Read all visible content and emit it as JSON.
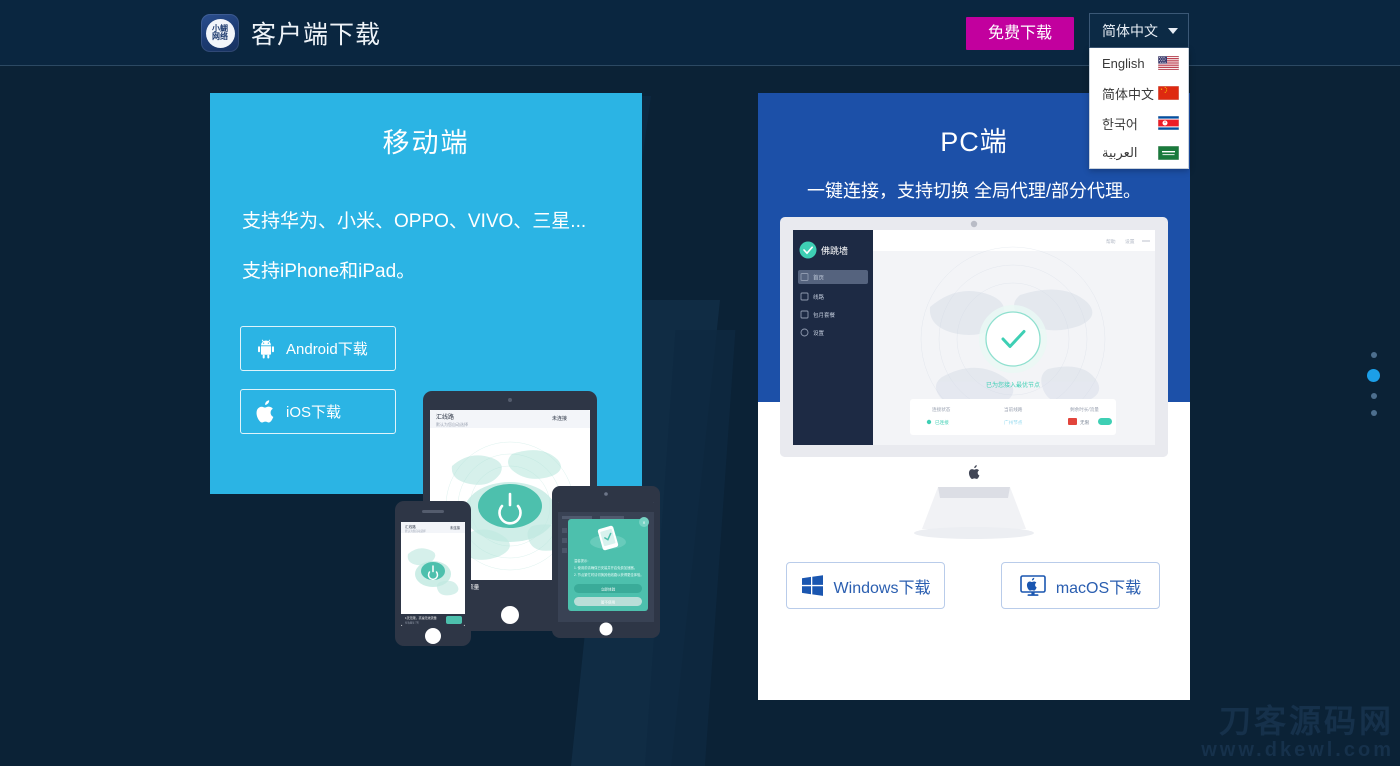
{
  "header": {
    "logo_text_top": "小蝴",
    "logo_text_bottom": "网络",
    "title": "客户端下载",
    "free_download_label": "免费下载",
    "language_selected": "简体中文",
    "accent_pink": "#c2009e",
    "bar_color": "#0a2640"
  },
  "language_menu": [
    {
      "label": "English",
      "flag": "us-flag-icon"
    },
    {
      "label": "简体中文",
      "flag": "cn-flag-icon"
    },
    {
      "label": "한국어",
      "flag": "kp-flag-icon"
    },
    {
      "label": "العربية",
      "flag": "sa-flag-icon"
    }
  ],
  "mobile": {
    "title": "移动端",
    "line1": "支持华为、小米、OPPO、VIVO、三星...",
    "line2": "支持iPhone和iPad。",
    "android_label": "Android下载",
    "ios_label": "iOS下载",
    "bg_color": "#2bb4e4"
  },
  "pc": {
    "title": "PC端",
    "subtitle": "一键连接，支持切换 全局代理/部分代理。",
    "windows_label": "Windows下载",
    "macos_label": "macOS下载",
    "bg_color": "#1c50a8"
  },
  "screen_app": {
    "brand": "佛跳墙",
    "nav": [
      "首页",
      "线路",
      "包月套餐",
      "设置"
    ],
    "status_text": "已为您接入最优节点",
    "card_headers": [
      "连接状态",
      "当前线路",
      "剩余时长/流量"
    ],
    "card_values": [
      "已连接",
      "广州节点",
      "无限"
    ]
  },
  "carousel": {
    "total": 4,
    "active_index": 1
  },
  "watermark": {
    "line1": "刀客源码网",
    "line2": "www.dkewl.com"
  }
}
